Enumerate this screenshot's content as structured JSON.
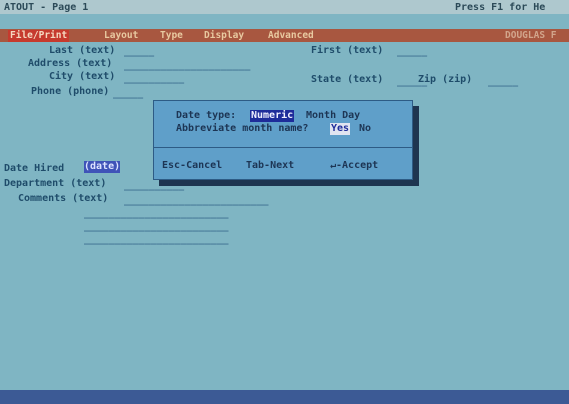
{
  "app": {
    "title_left": "ATOUT - Page 1",
    "title_right": "Press F1 for He"
  },
  "menu": {
    "items": [
      "File/Print",
      "Layout",
      "Type",
      "Display",
      "Advanced"
    ],
    "right_text": "DOUGLAS F"
  },
  "form": {
    "last_label": "Last (text)",
    "first_label": "First (text)",
    "address_label": "Address (text)",
    "city_label": "City (text)",
    "state_label": "State (text)",
    "zip_label": "Zip (zip)",
    "phone_label": "Phone (phone)",
    "date_hired_label": "Date Hired",
    "date_hired_type": "(date)",
    "department_label": "Department (text)",
    "comments_label": "Comments (text)",
    "blank_short": "_____",
    "blank_medium": "__________",
    "blank_long": "_____________________",
    "blank_xlong": "________________________"
  },
  "dialog": {
    "date_type_label": "Date type:",
    "date_type_options": [
      "Numeric",
      "Month Day"
    ],
    "date_type_selected": "Numeric",
    "abbreviate_label": "Abbreviate month name?",
    "abbreviate_options": [
      "Yes",
      "No"
    ],
    "abbreviate_selected": "Yes",
    "footer": [
      "Esc-Cancel",
      "Tab-Next",
      "↵-Accept"
    ]
  },
  "colors": {
    "screen_bg": "#7fb5c3",
    "menu_bar": "#a85740",
    "dialog_bg": "#5f9fc9",
    "highlight": "#3f53b8",
    "bottom_bar": "#3c5a95"
  }
}
